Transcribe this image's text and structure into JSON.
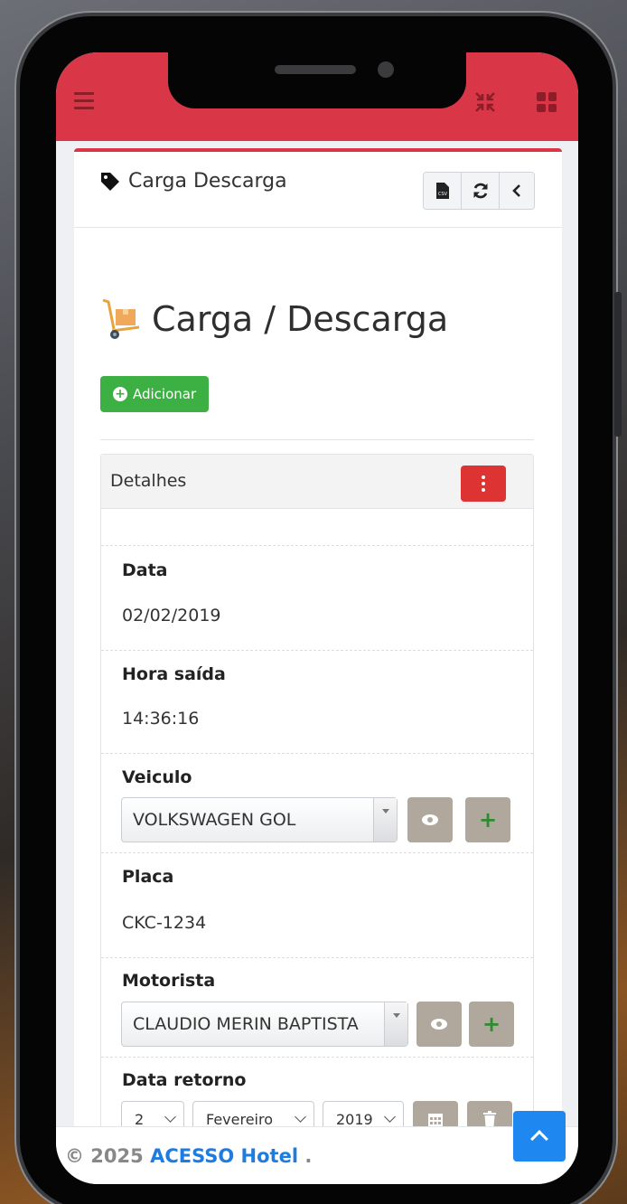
{
  "card": {
    "title": "Carga Descarga",
    "toolbar": {
      "csv_label": "CSV"
    }
  },
  "page": {
    "heading": "Carga / Descarga",
    "add_button": "Adicionar"
  },
  "panel": {
    "title": "Detalhes",
    "fields": {
      "data": {
        "label": "Data",
        "value": "02/02/2019"
      },
      "hora_saida": {
        "label": "Hora saída",
        "value": "14:36:16"
      },
      "veiculo": {
        "label": "Veiculo",
        "value": "VOLKSWAGEN GOL"
      },
      "placa": {
        "label": "Placa",
        "value": "CKC-1234"
      },
      "motorista": {
        "label": "Motorista",
        "value": "CLAUDIO MERIN BAPTISTA"
      },
      "data_retorno": {
        "label": "Data retorno",
        "day": "2",
        "month": "Fevereiro",
        "year": "2019"
      }
    }
  },
  "footer": {
    "prefix": "© 2025 ",
    "brand": "ACESSO Hotel",
    "suffix": " ."
  },
  "colors": {
    "topbar": "#d93647",
    "success": "#3cb043",
    "danger": "#dd3333",
    "link": "#1e7be0",
    "scroll_top": "#1e88f0"
  }
}
